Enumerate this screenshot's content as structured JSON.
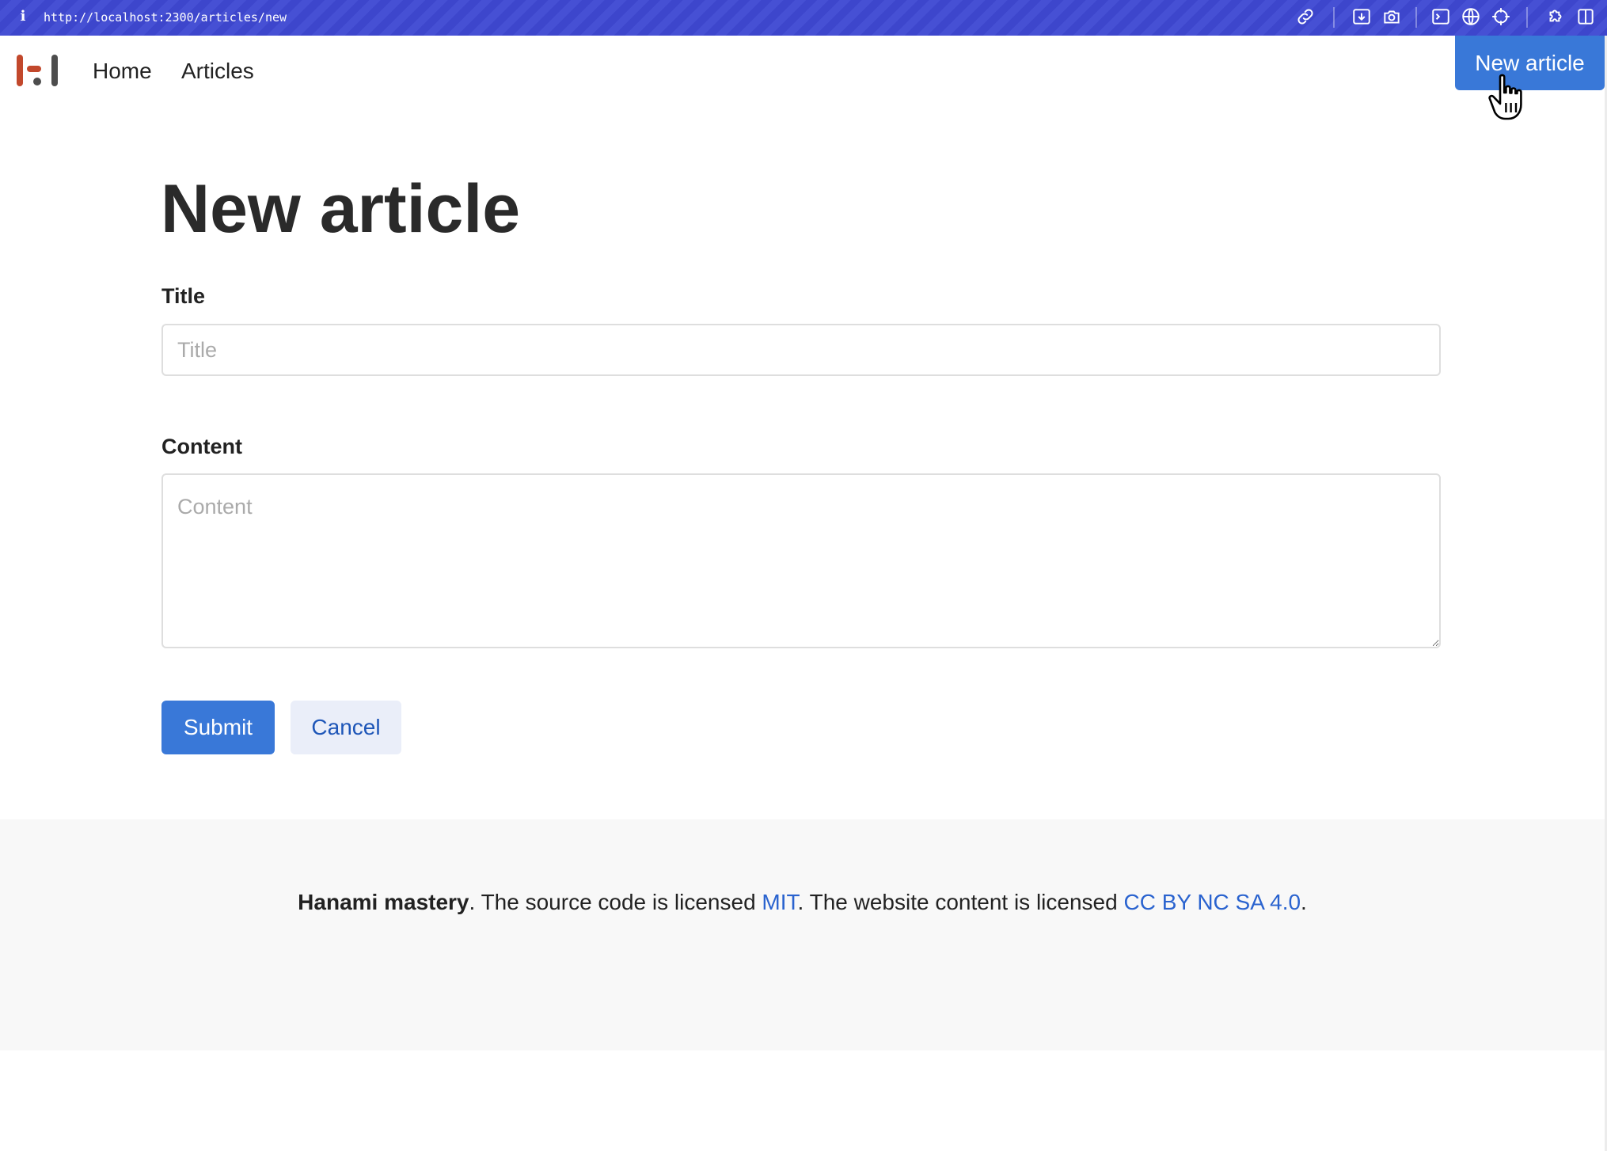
{
  "browser": {
    "url": "http://localhost:2300/articles/new",
    "info_glyph": "i",
    "toolbar_icons": [
      "link-icon",
      "download-icon",
      "camera-icon",
      "terminal-icon",
      "globe-icon",
      "crosshair-icon",
      "extensions-icon",
      "sidebar-icon"
    ]
  },
  "header": {
    "logo_colors": {
      "orange": "#c2482c",
      "gray": "#4d4d4d"
    },
    "nav": [
      {
        "label": "Home"
      },
      {
        "label": "Articles"
      }
    ],
    "new_article_button": "New article"
  },
  "main": {
    "page_title": "New article",
    "title_field": {
      "label": "Title",
      "placeholder": "Title",
      "value": ""
    },
    "content_field": {
      "label": "Content",
      "placeholder": "Content",
      "value": ""
    },
    "submit_label": "Submit",
    "cancel_label": "Cancel"
  },
  "footer": {
    "brand": "Hanami mastery",
    "text_1": ". The source code is licensed ",
    "mit_link": "MIT",
    "text_2": ". The website content is licensed ",
    "cc_link": "CC BY NC SA 4.0",
    "text_3": "."
  },
  "colors": {
    "browser_bar": "#3d46cc",
    "primary": "#3978d8",
    "link": "#2a63cf",
    "cancel_bg": "#eaeef9",
    "footer_bg": "#f8f8f8"
  }
}
